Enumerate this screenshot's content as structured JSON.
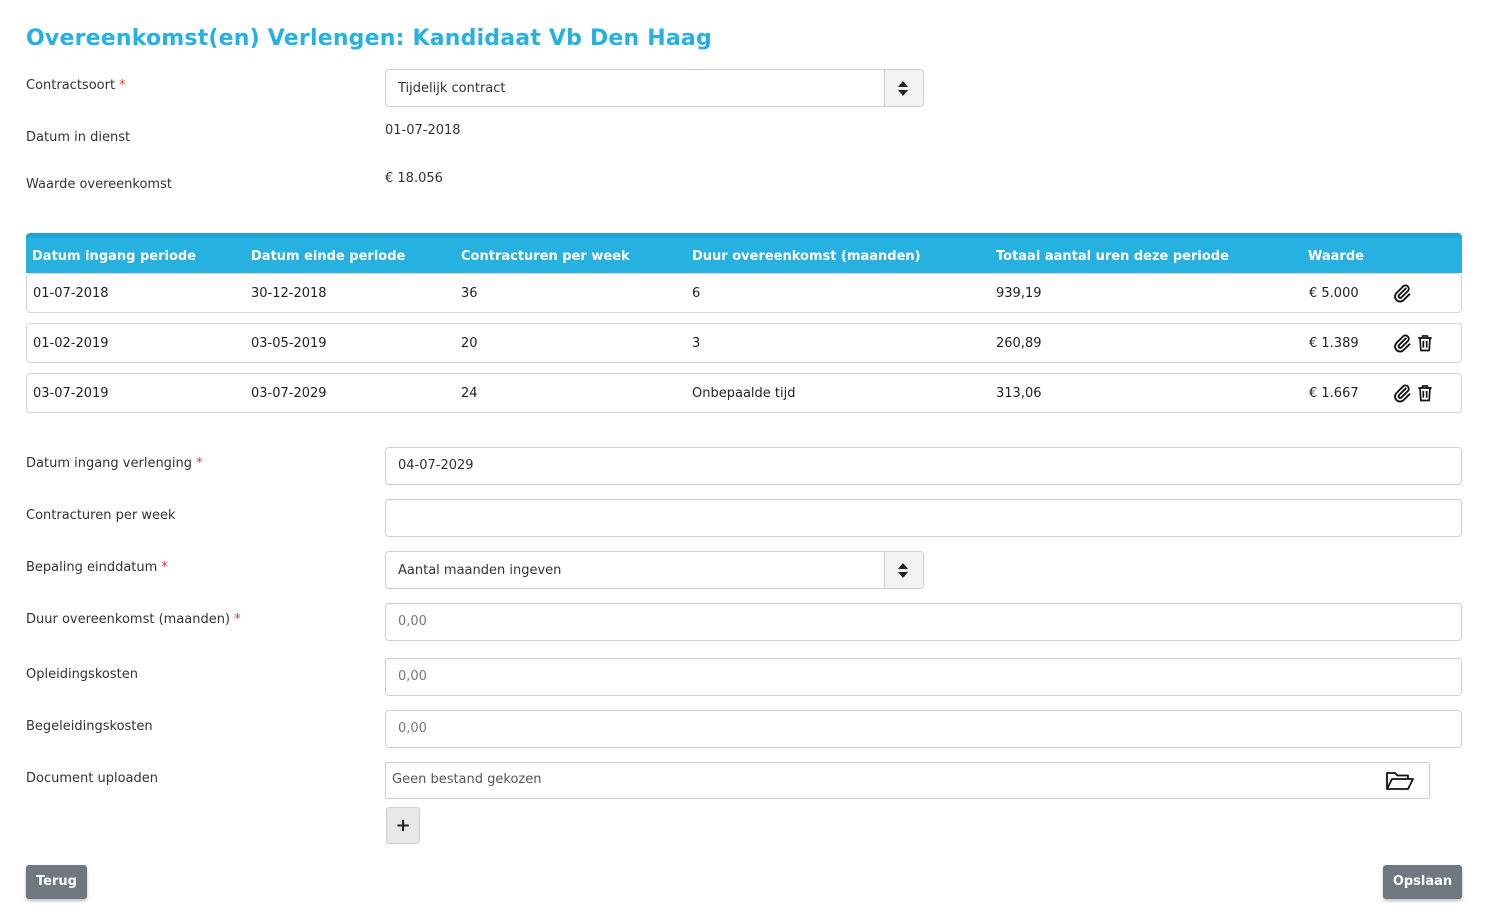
{
  "page": {
    "title": "Overeenkomst(en) Verlengen: Kandidaat Vb Den Haag"
  },
  "colors": {
    "accent": "#27b1e0",
    "required": "#e03b3b",
    "button": "#6f7880"
  },
  "summary": {
    "contract_type_label": "Contractsoort",
    "contract_type_value": "Tijdelijk contract",
    "start_label": "Datum in dienst",
    "start_value": "01-07-2018",
    "value_label": "Waarde overeenkomst",
    "value_value": "€ 18.056"
  },
  "table": {
    "headers": [
      "Datum ingang periode",
      "Datum einde periode",
      "Contracturen per week",
      "Duur overeenkomst (maanden)",
      "Totaal aantal uren deze periode",
      "Waarde"
    ],
    "rows": [
      {
        "start": "01-07-2018",
        "end": "30-12-2018",
        "hours": "36",
        "duration": "6",
        "total": "939,19",
        "value": "€ 5.000",
        "icons": [
          "paperclip-icon"
        ]
      },
      {
        "start": "01-02-2019",
        "end": "03-05-2019",
        "hours": "20",
        "duration": "3",
        "total": "260,89",
        "value": "€ 1.389",
        "icons": [
          "paperclip-icon",
          "trash-icon"
        ]
      },
      {
        "start": "03-07-2019",
        "end": "03-07-2029",
        "hours": "24",
        "duration": "Onbepaalde tijd",
        "total": "313,06",
        "value": "€ 1.667",
        "icons": [
          "paperclip-icon",
          "trash-icon"
        ]
      }
    ]
  },
  "form": {
    "start_ext_label": "Datum ingang verlenging",
    "start_ext_value": "04-07-2029",
    "hours_label": "Contracturen per week",
    "hours_value": "",
    "enddate_label": "Bepaling einddatum",
    "enddate_value": "Aantal maanden ingeven",
    "duration_label": "Duur overeenkomst (maanden)",
    "duration_placeholder": "0,00",
    "training_label": "Opleidingskosten",
    "training_placeholder": "0,00",
    "guidance_label": "Begeleidingskosten",
    "guidance_placeholder": "0,00",
    "upload_label": "Document uploaden",
    "upload_placeholder": "Geen bestand gekozen",
    "add_label": "+",
    "required_mark": "*"
  },
  "actions": {
    "back_label": "Terug",
    "save_label": "Opslaan"
  }
}
